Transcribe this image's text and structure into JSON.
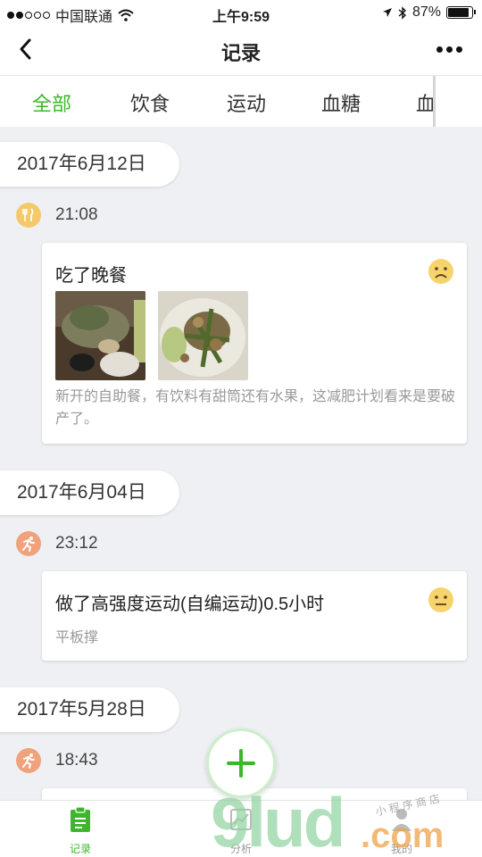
{
  "status_bar": {
    "carrier": "中国联通",
    "time": "上午9:59",
    "battery": "87%",
    "battery_level": 0.87
  },
  "nav": {
    "title": "记录"
  },
  "tabs": [
    "全部",
    "饮食",
    "运动",
    "血糖",
    "血"
  ],
  "records": [
    {
      "date": "2017年6月12日",
      "time": "21:08",
      "category_icon": "fork-knife-icon",
      "title": "吃了晚餐",
      "mood_icon": "sad-face-icon",
      "description": "新开的自助餐，有饮料有甜筒还有水果，这减肥计划看来是要破产了。"
    },
    {
      "date": "2017年6月04日",
      "time": "23:12",
      "category_icon": "running-icon",
      "title": "做了高强度运动(自编运动)0.5小时",
      "mood_icon": "neutral-face-icon",
      "description": "平板撑"
    },
    {
      "date": "2017年5月28日",
      "time": "18:43",
      "category_icon": "running-icon"
    }
  ],
  "bottom_tabs": [
    {
      "label": "记录",
      "icon": "clipboard-icon"
    },
    {
      "label": "分析",
      "icon": "chart-icon"
    },
    {
      "label": "我的",
      "icon": "person-icon"
    }
  ],
  "watermark": {
    "main": "9lud",
    "suffix": ".com",
    "caption": "小 程 序 商 店"
  },
  "colors": {
    "accent": "#3db62c",
    "food": "#f5c96a",
    "sport": "#f0a27d",
    "background": "#eff0f4"
  }
}
